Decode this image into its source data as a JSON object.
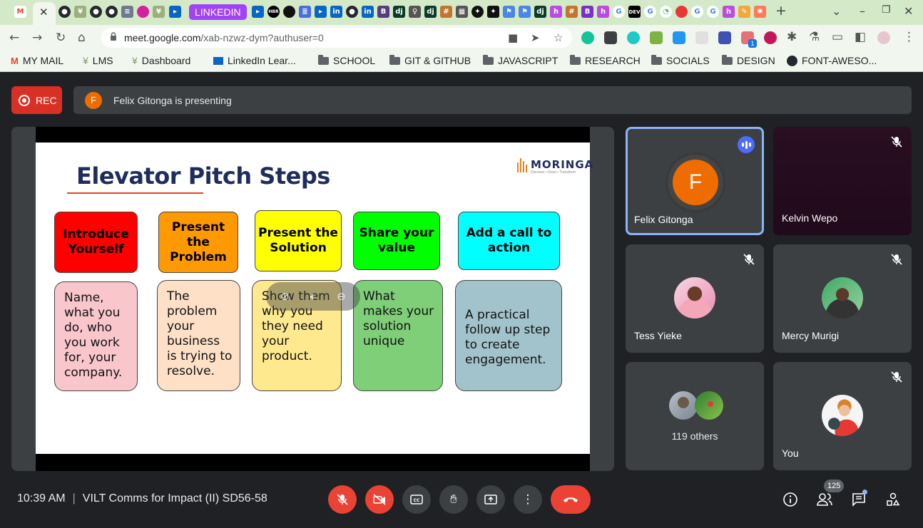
{
  "browser": {
    "tab_group_label": "LINKEDIN",
    "address": {
      "host": "meet.google.com",
      "path": "/xab-nzwz-dym?authuser=0"
    },
    "bookmarks": [
      {
        "label": "MY MAIL",
        "icon": "gmail-icon"
      },
      {
        "label": "LMS",
        "icon": "palm-icon"
      },
      {
        "label": "Dashboard",
        "icon": "palm-icon"
      },
      {
        "label": "LinkedIn Lear...",
        "icon": "linkedin-learning-icon"
      },
      {
        "label": "SCHOOL",
        "icon": "folder-icon"
      },
      {
        "label": "GIT & GITHUB",
        "icon": "folder-icon"
      },
      {
        "label": "JAVASCRIPT",
        "icon": "folder-icon"
      },
      {
        "label": "RESEARCH",
        "icon": "folder-icon"
      },
      {
        "label": "SOCIALS",
        "icon": "folder-icon"
      },
      {
        "label": "DESIGN",
        "icon": "folder-icon"
      },
      {
        "label": "FONT-AWESO...",
        "icon": "github-icon"
      }
    ],
    "extension_badge": "1"
  },
  "meet": {
    "rec_label": "REC",
    "presenter_initial": "F",
    "presenting_text": "Felix Gitonga is presenting",
    "time": "10:39 AM",
    "separator": "|",
    "meeting_title": "VILT Comms for Impact (II) SD56-58",
    "people_count": "125",
    "colors": {
      "record_red": "#d93025",
      "control_red": "#ea4335",
      "speaking_blue": "#4d6bfe",
      "avatar_orange": "#ef6c00"
    }
  },
  "slide": {
    "title": "Elevator Pitch Steps",
    "brand": "MORINGA",
    "brand_tagline": "Discover • Grow • Transform",
    "steps": [
      {
        "heading": "Introduce Yourself",
        "detail": "Name, what you do, who you work for, your company.",
        "head_color": "#ff0000",
        "body_color": "#f9c6cc"
      },
      {
        "heading": "Present the Problem",
        "detail": "The problem your business is trying to resolve.",
        "head_color": "#ff9900",
        "body_color": "#fde0c6"
      },
      {
        "heading": "Present the Solution",
        "detail": "Show them why you they need your product.",
        "head_color": "#ffff00",
        "body_color": "#ffe98f"
      },
      {
        "heading": "Share your value",
        "detail": "What makes your solution unique",
        "head_color": "#00ff00",
        "body_color": "#7fce78"
      },
      {
        "heading": "Add a call to action",
        "detail": "A practical follow up step to create engagement.",
        "head_color": "#00ffff",
        "body_color": "#a2c3cb"
      }
    ]
  },
  "participants": [
    {
      "name": "Felix Gitonga",
      "initial": "F",
      "speaking": true
    },
    {
      "name": "Kelvin Wepo",
      "muted": true
    },
    {
      "name": "Tess Yieke",
      "muted": true
    },
    {
      "name": "Mercy Murigi",
      "muted": true
    },
    {
      "name": "119 others"
    },
    {
      "name": "You",
      "muted": true
    }
  ]
}
